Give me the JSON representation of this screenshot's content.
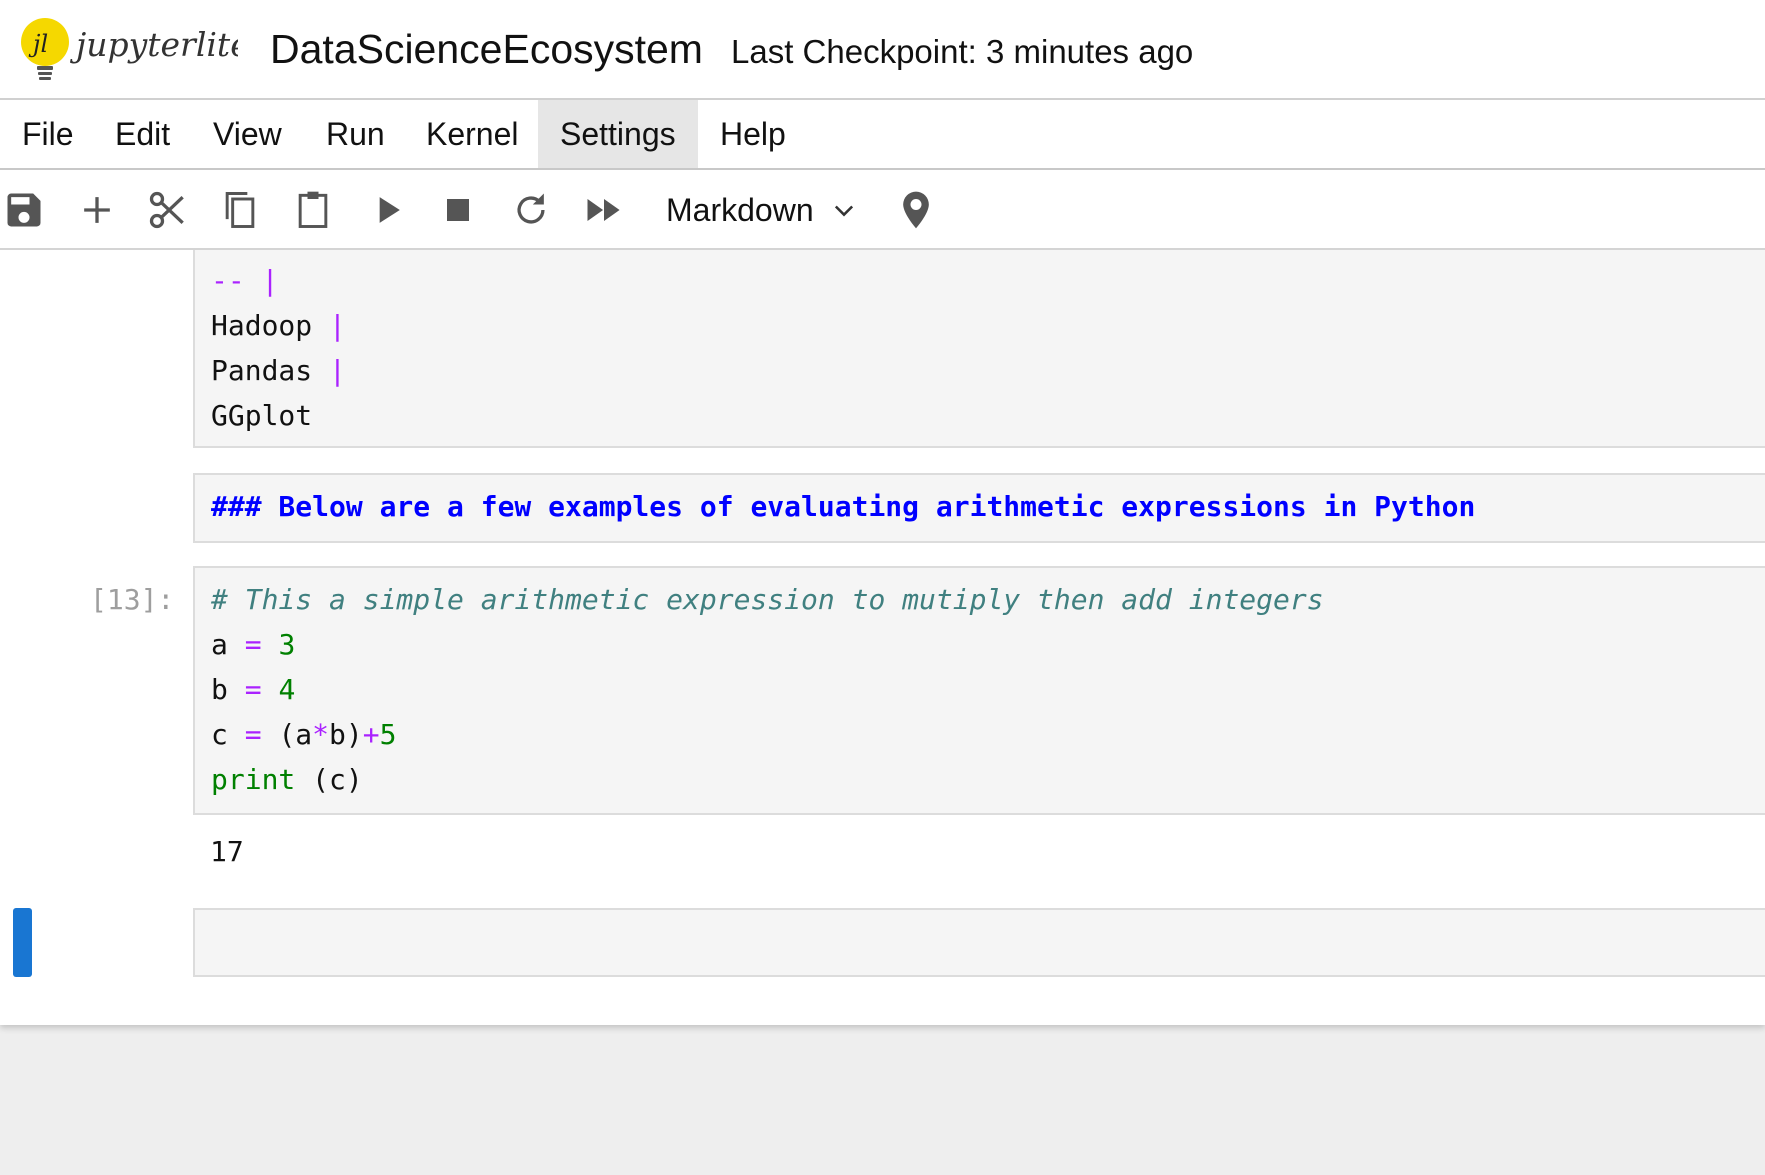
{
  "header": {
    "logo_text": "jupyterlite",
    "title": "DataScienceEcosystem",
    "checkpoint": "Last Checkpoint: 3 minutes ago"
  },
  "menu": {
    "items": [
      "File",
      "Edit",
      "View",
      "Run",
      "Kernel",
      "Settings",
      "Help"
    ],
    "active": "Settings"
  },
  "toolbar": {
    "buttons": [
      "save-icon",
      "add-icon",
      "cut-icon",
      "copy-icon",
      "paste-icon",
      "run-icon",
      "stop-icon",
      "restart-icon",
      "run-all-icon"
    ],
    "cell_type": "Markdown",
    "extra_icon": "marker-icon"
  },
  "cells": {
    "table_tail": {
      "line1_dashes": "--",
      "line1_pipe": "|",
      "rows": [
        {
          "text": "Hadoop",
          "pipe": "|"
        },
        {
          "text": "Pandas",
          "pipe": "|"
        },
        {
          "text": "GGplot",
          "pipe": ""
        }
      ]
    },
    "markdown_heading": "### Below are a few examples of evaluating arithmetic expressions in Python",
    "code": {
      "prompt": "[13]:",
      "comment": "# This a simple arithmetic expression to mutiply then add integers",
      "line_a": {
        "var": "a",
        "op": "=",
        "val": "3"
      },
      "line_b": {
        "var": "b",
        "op": "=",
        "val": "4"
      },
      "line_c": {
        "var": "c",
        "op": "=",
        "open": "(a",
        "mul": "*",
        "close": "b)",
        "plus": "+",
        "val": "5"
      },
      "line_print": {
        "fn": "print",
        "args": " (c)"
      }
    },
    "output": "17",
    "empty_cell": ""
  },
  "colors": {
    "accent": "#1976d2",
    "keyword": "#aa22ff",
    "number": "#008000",
    "comment": "#408080",
    "markdown_heading": "#0000ff"
  }
}
